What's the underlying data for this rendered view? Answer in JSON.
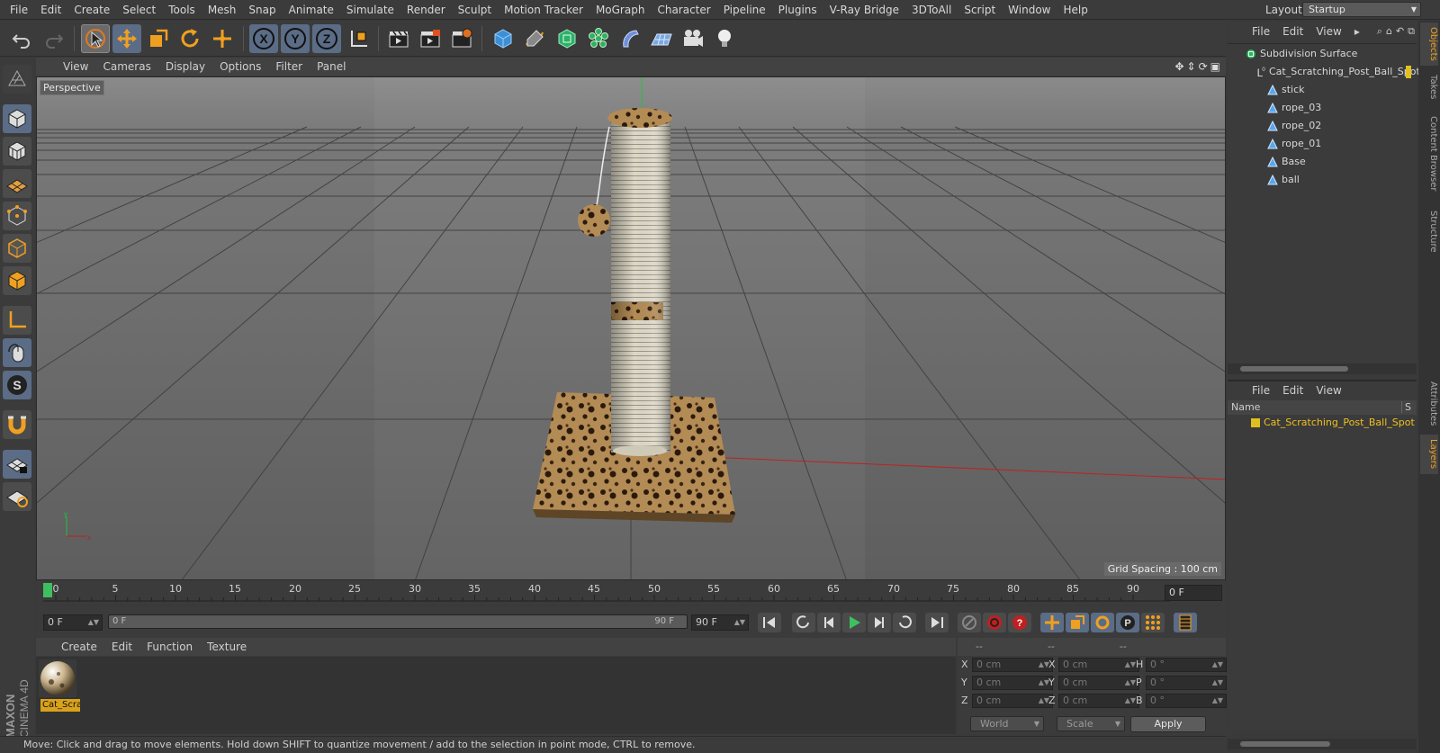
{
  "menubar": {
    "items": [
      "File",
      "Edit",
      "Create",
      "Select",
      "Tools",
      "Mesh",
      "Snap",
      "Animate",
      "Simulate",
      "Render",
      "Sculpt",
      "Motion Tracker",
      "MoGraph",
      "Character",
      "Pipeline",
      "Plugins",
      "V-Ray Bridge",
      "3DToAll",
      "Script",
      "Window",
      "Help"
    ],
    "layout_label": "Layout:",
    "layout_value": "Startup"
  },
  "viewport": {
    "menus": [
      "View",
      "Cameras",
      "Display",
      "Options",
      "Filter",
      "Panel"
    ],
    "camera_label": "Perspective",
    "grid_spacing": "Grid Spacing : 100 cm"
  },
  "timeline": {
    "ticks": [
      "0",
      "5",
      "10",
      "15",
      "20",
      "25",
      "30",
      "35",
      "40",
      "45",
      "50",
      "55",
      "60",
      "65",
      "70",
      "75",
      "80",
      "85",
      "90"
    ],
    "current_frame": "0 F"
  },
  "transport": {
    "start_field": "0 F",
    "range_start": "0 F",
    "range_end": "90 F",
    "end_field": "90 F"
  },
  "material_manager": {
    "menus": [
      "Create",
      "Edit",
      "Function",
      "Texture"
    ],
    "material_name": "Cat_Scra"
  },
  "coordinates": {
    "col_headers": [
      "--",
      "--",
      "--"
    ],
    "rows": [
      {
        "l1": "X",
        "v1": "0 cm",
        "l2": "X",
        "v2": "0 cm",
        "l3": "H",
        "v3": "0 °"
      },
      {
        "l1": "Y",
        "v1": "0 cm",
        "l2": "Y",
        "v2": "0 cm",
        "l3": "P",
        "v3": "0 °"
      },
      {
        "l1": "Z",
        "v1": "0 cm",
        "l2": "Z",
        "v2": "0 cm",
        "l3": "B",
        "v3": "0 °"
      }
    ],
    "space_select": "World",
    "mode_select": "Scale",
    "apply_label": "Apply"
  },
  "status": "Move: Click and drag to move elements. Hold down SHIFT to quantize movement / add to the selection in point mode, CTRL to remove.",
  "object_manager": {
    "menus": [
      "File",
      "Edit",
      "View"
    ],
    "objects": [
      {
        "name": "Subdivision Surface",
        "indent": 0,
        "type": "subdiv"
      },
      {
        "name": "Cat_Scratching_Post_Ball_Spot",
        "indent": 1,
        "type": "null"
      },
      {
        "name": "stick",
        "indent": 2,
        "type": "poly"
      },
      {
        "name": "rope_03",
        "indent": 2,
        "type": "poly"
      },
      {
        "name": "rope_02",
        "indent": 2,
        "type": "poly"
      },
      {
        "name": "rope_01",
        "indent": 2,
        "type": "poly"
      },
      {
        "name": "Base",
        "indent": 2,
        "type": "poly"
      },
      {
        "name": "ball",
        "indent": 2,
        "type": "poly"
      }
    ]
  },
  "layer_manager": {
    "menus": [
      "File",
      "Edit",
      "View"
    ],
    "column_name": "Name",
    "column_s": "S",
    "layers": [
      {
        "name": "Cat_Scratching_Post_Ball_Spot",
        "color": "#e0c020"
      }
    ]
  },
  "side_tabs": [
    "Objects",
    "Takes",
    "Content Browser",
    "Structure",
    "Attributes",
    "Layers"
  ],
  "brand": {
    "logo_text_1": "MAXON",
    "logo_text_2": "CINEMA 4D"
  },
  "colors": {
    "accent": "#f0a020",
    "selected_blue": "#5b6c86",
    "layer_text": "#f0c020"
  }
}
